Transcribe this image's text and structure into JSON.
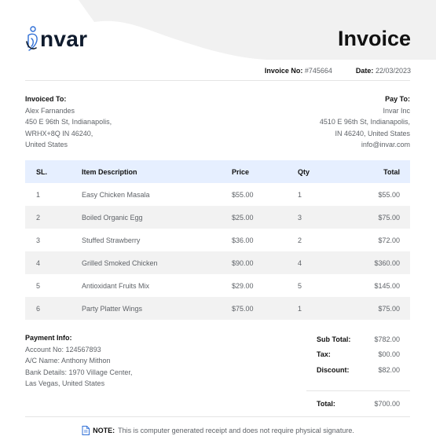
{
  "brand": {
    "logo_text": "nvar",
    "accent": "#2f6fd6",
    "band": "#f0f0f0"
  },
  "title": "Invoice",
  "meta": {
    "no_label": "Invoice No:",
    "no_value": "#745664",
    "date_label": "Date:",
    "date_value": "22/03/2023"
  },
  "invoiced_to": {
    "heading": "Invoiced To:",
    "lines": [
      "Alex Farnandes",
      "450 E 96th St, Indianapolis,",
      "WRHX+8Q IN 46240,",
      "United States"
    ]
  },
  "pay_to": {
    "heading": "Pay To:",
    "lines": [
      "Invar Inc",
      "4510 E 96th St, Indianapolis,",
      "IN 46240, United States",
      "info@invar.com"
    ]
  },
  "table": {
    "headers": [
      "SL.",
      "Item Description",
      "Price",
      "Qty",
      "Total"
    ],
    "rows": [
      [
        "1",
        "Easy Chicken Masala",
        "$55.00",
        "1",
        "$55.00"
      ],
      [
        "2",
        "Boiled Organic Egg",
        "$25.00",
        "3",
        "$75.00"
      ],
      [
        "3",
        "Stuffed Strawberry",
        "$36.00",
        "2",
        "$72.00"
      ],
      [
        "4",
        "Grilled Smoked Chicken",
        "$90.00",
        "4",
        "$360.00"
      ],
      [
        "5",
        "Antioxidant Fruits Mix",
        "$29.00",
        "5",
        "$145.00"
      ],
      [
        "6",
        "Party Platter Wings",
        "$75.00",
        "1",
        "$75.00"
      ]
    ]
  },
  "payment": {
    "heading": "Payment Info:",
    "lines": [
      "Account No: 124567893",
      "A/C Name: Anthony Mithon",
      "Bank Details: 1970 Village Center,",
      "Las Vegas, United States"
    ]
  },
  "totals": {
    "subtotal_label": "Sub Total:",
    "subtotal": "$782.00",
    "tax_label": "Tax:",
    "tax": "$00.00",
    "discount_label": "Discount:",
    "discount": "$82.00",
    "total_label": "Total:",
    "total": "$700.00"
  },
  "note": {
    "label": "NOTE:",
    "text": "This is computer generated receipt and does not require physical signature."
  }
}
